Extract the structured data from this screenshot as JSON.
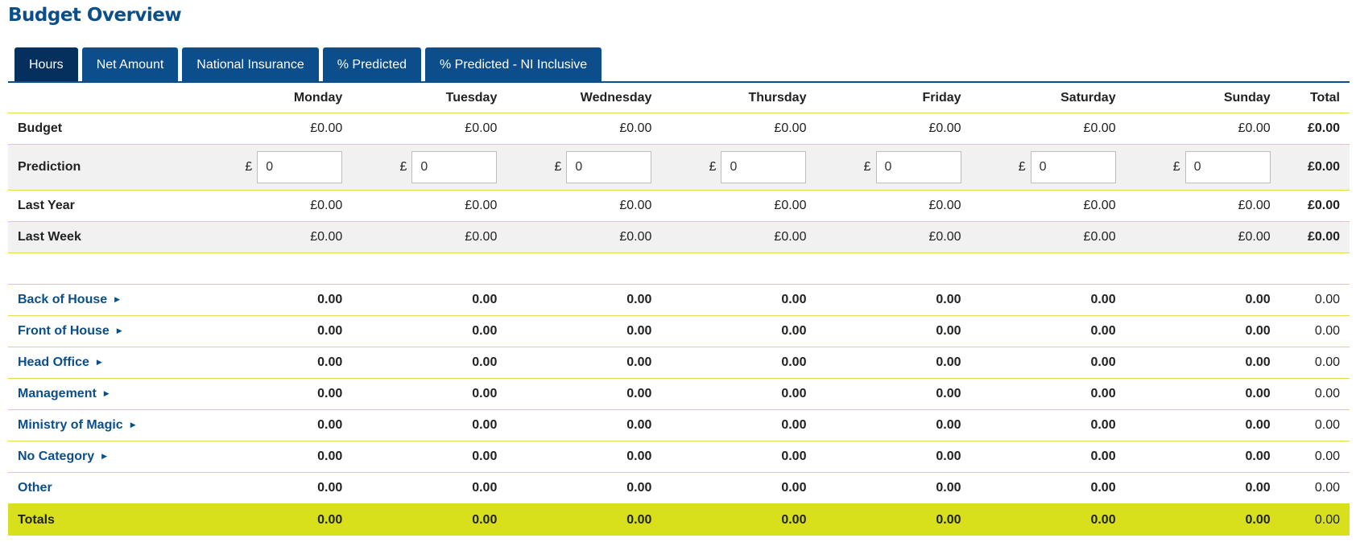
{
  "page": {
    "title": "Budget Overview"
  },
  "tabs": [
    {
      "label": "Hours",
      "active": true
    },
    {
      "label": "Net Amount",
      "active": false
    },
    {
      "label": "National Insurance",
      "active": false
    },
    {
      "label": "% Predicted",
      "active": false
    },
    {
      "label": "% Predicted - NI Inclusive",
      "active": false
    }
  ],
  "table": {
    "columns": [
      "Monday",
      "Tuesday",
      "Wednesday",
      "Thursday",
      "Friday",
      "Saturday",
      "Sunday",
      "Total"
    ],
    "budget": {
      "label": "Budget",
      "values": [
        "£0.00",
        "£0.00",
        "£0.00",
        "£0.00",
        "£0.00",
        "£0.00",
        "£0.00"
      ],
      "total": "£0.00"
    },
    "prediction": {
      "label": "Prediction",
      "currency": "£",
      "values": [
        "0",
        "0",
        "0",
        "0",
        "0",
        "0",
        "0"
      ],
      "total": "£0.00"
    },
    "last_year": {
      "label": "Last Year",
      "values": [
        "£0.00",
        "£0.00",
        "£0.00",
        "£0.00",
        "£0.00",
        "£0.00",
        "£0.00"
      ],
      "total": "£0.00"
    },
    "last_week": {
      "label": "Last Week",
      "values": [
        "£0.00",
        "£0.00",
        "£0.00",
        "£0.00",
        "£0.00",
        "£0.00",
        "£0.00"
      ],
      "total": "£0.00"
    },
    "categories": [
      {
        "label": "Back of House",
        "expandable": true,
        "values": [
          "0.00",
          "0.00",
          "0.00",
          "0.00",
          "0.00",
          "0.00",
          "0.00"
        ],
        "total": "0.00"
      },
      {
        "label": "Front of House",
        "expandable": true,
        "values": [
          "0.00",
          "0.00",
          "0.00",
          "0.00",
          "0.00",
          "0.00",
          "0.00"
        ],
        "total": "0.00"
      },
      {
        "label": "Head Office",
        "expandable": true,
        "values": [
          "0.00",
          "0.00",
          "0.00",
          "0.00",
          "0.00",
          "0.00",
          "0.00"
        ],
        "total": "0.00"
      },
      {
        "label": "Management",
        "expandable": true,
        "values": [
          "0.00",
          "0.00",
          "0.00",
          "0.00",
          "0.00",
          "0.00",
          "0.00"
        ],
        "total": "0.00"
      },
      {
        "label": "Ministry of Magic",
        "expandable": true,
        "values": [
          "0.00",
          "0.00",
          "0.00",
          "0.00",
          "0.00",
          "0.00",
          "0.00"
        ],
        "total": "0.00"
      },
      {
        "label": "No Category",
        "expandable": true,
        "values": [
          "0.00",
          "0.00",
          "0.00",
          "0.00",
          "0.00",
          "0.00",
          "0.00"
        ],
        "total": "0.00"
      },
      {
        "label": "Other",
        "expandable": false,
        "values": [
          "0.00",
          "0.00",
          "0.00",
          "0.00",
          "0.00",
          "0.00",
          "0.00"
        ],
        "total": "0.00"
      }
    ],
    "totals": {
      "label": "Totals",
      "values": [
        "0.00",
        "0.00",
        "0.00",
        "0.00",
        "0.00",
        "0.00",
        "0.00"
      ],
      "total": "0.00"
    }
  },
  "colors": {
    "brand_blue": "#0c4e8c",
    "active_tab": "#052f5c",
    "totals_bg": "#d8e01c",
    "row_border": "#e4dc4a",
    "alt_row_bg": "#f1f1f1"
  }
}
